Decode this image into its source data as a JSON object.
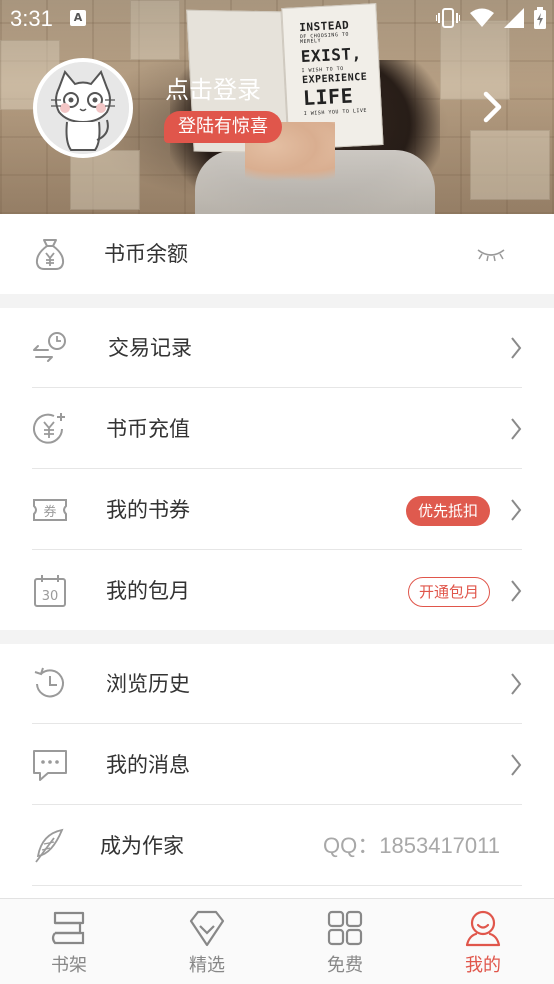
{
  "status_bar": {
    "time": "3:31",
    "notification_letter": "A"
  },
  "header": {
    "login_title": "点击登录",
    "login_badge": "登陆有惊喜",
    "book_lines": [
      "INSTEAD",
      "OF CHOOSING TO MERELY",
      "EXIST,",
      "I WISH TO TO",
      "EXPERIENCE",
      "LIFE",
      "I WISH YOU TO LIVE"
    ]
  },
  "balance": {
    "label": "书币余额",
    "hidden_icon": "eye-closed-icon"
  },
  "menu_group_1": [
    {
      "label": "交易记录",
      "icon": "transaction-clock-icon"
    },
    {
      "label": "书币充值",
      "icon": "recharge-coin-icon"
    },
    {
      "label": "我的书券",
      "icon": "coupon-icon",
      "tag": "优先抵扣"
    },
    {
      "label": "我的包月",
      "icon": "calendar-30-icon",
      "tag": "开通包月"
    }
  ],
  "menu_group_2": [
    {
      "label": "浏览历史",
      "icon": "history-icon"
    },
    {
      "label": "我的消息",
      "icon": "message-icon"
    },
    {
      "label": "成为作家",
      "icon": "feather-icon",
      "contact": "QQ：1853417011"
    }
  ],
  "tabbar": {
    "tabs": [
      {
        "label": "书架",
        "icon": "bookshelf-icon",
        "active": false
      },
      {
        "label": "精选",
        "icon": "diamond-icon",
        "active": false
      },
      {
        "label": "免费",
        "icon": "grid-icon",
        "active": false
      },
      {
        "label": "我的",
        "icon": "profile-icon",
        "active": true
      }
    ]
  },
  "colors": {
    "accent": "#e0564b",
    "text": "#333333",
    "muted": "#a8a8a8",
    "icon": "#9a9a9a"
  }
}
